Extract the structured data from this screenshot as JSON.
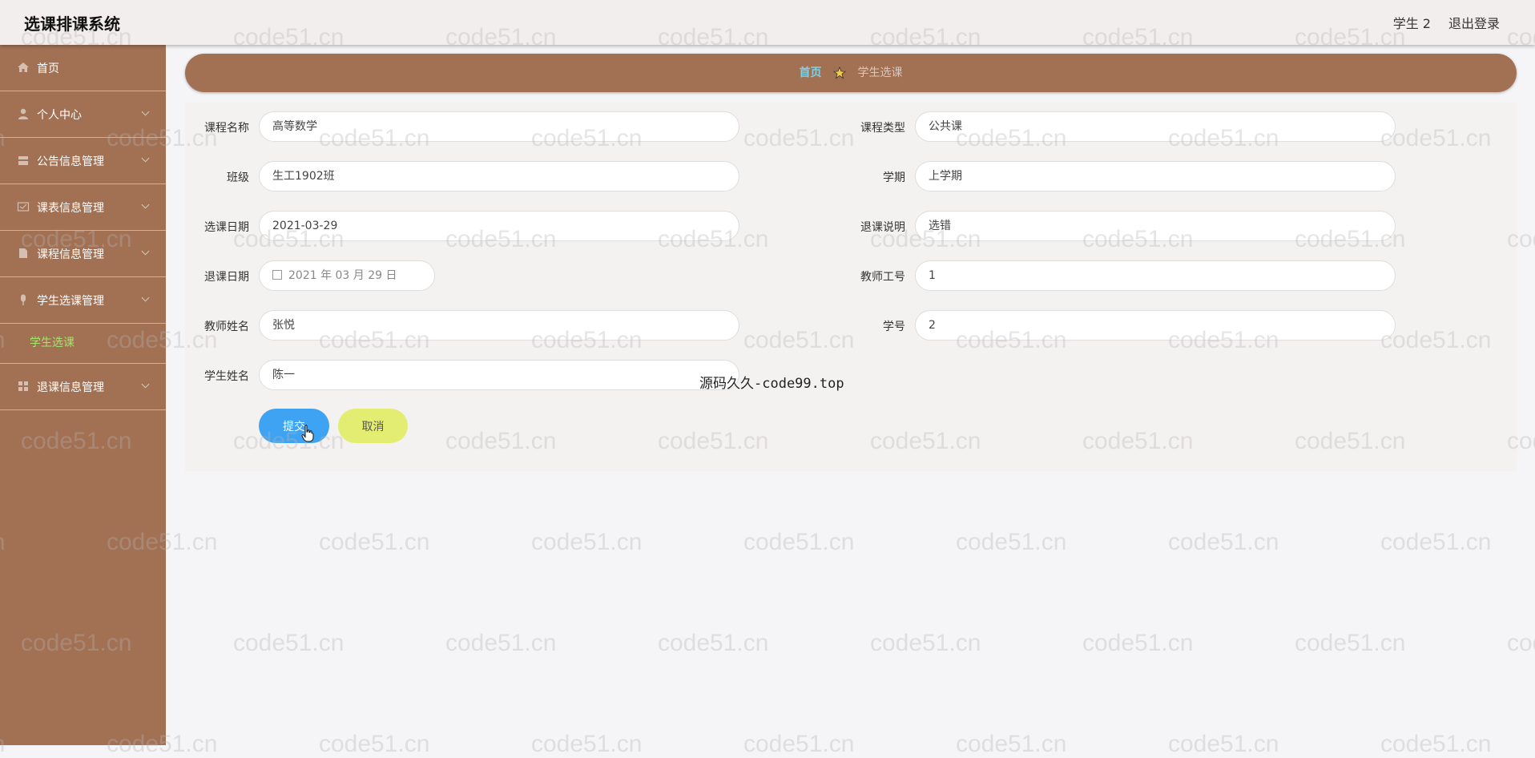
{
  "header": {
    "app_title": "选课排课系统",
    "user_label": "学生 2",
    "logout_label": "退出登录"
  },
  "sidebar": {
    "items": [
      {
        "label": "首页",
        "icon": "home-icon"
      },
      {
        "label": "个人中心",
        "icon": "user-icon"
      },
      {
        "label": "公告信息管理",
        "icon": "notice-icon"
      },
      {
        "label": "课表信息管理",
        "icon": "schedule-icon"
      },
      {
        "label": "课程信息管理",
        "icon": "course-icon"
      },
      {
        "label": "学生选课管理",
        "icon": "select-icon"
      },
      {
        "label": "退课信息管理",
        "icon": "grid-icon"
      }
    ],
    "sub_item": "学生选课"
  },
  "breadcrumb": {
    "home": "首页",
    "current": "学生选课"
  },
  "form": {
    "course_name_label": "课程名称",
    "course_name_value": "高等数学",
    "course_type_label": "课程类型",
    "course_type_value": "公共课",
    "class_label": "班级",
    "class_value": "生工1902班",
    "term_label": "学期",
    "term_value": "上学期",
    "select_date_label": "选课日期",
    "select_date_value": "2021-03-29",
    "drop_note_label": "退课说明",
    "drop_note_value": "选错",
    "drop_date_label": "退课日期",
    "drop_date_value": "2021 年 03 月 29 日",
    "teacher_no_label": "教师工号",
    "teacher_no_value": "1",
    "teacher_name_label": "教师姓名",
    "teacher_name_value": "张悦",
    "student_no_label": "学号",
    "student_no_value": "2",
    "student_name_label": "学生姓名",
    "student_name_value": "陈一",
    "submit_label": "提交",
    "cancel_label": "取消"
  },
  "overlay_text": "源码久久-code99.top",
  "watermark_text": "code51.cn",
  "colors": {
    "sidebar": "#a27154",
    "submit": "#3fa3f3",
    "cancel": "#e3ed72",
    "active_sub": "#9fe86b"
  }
}
